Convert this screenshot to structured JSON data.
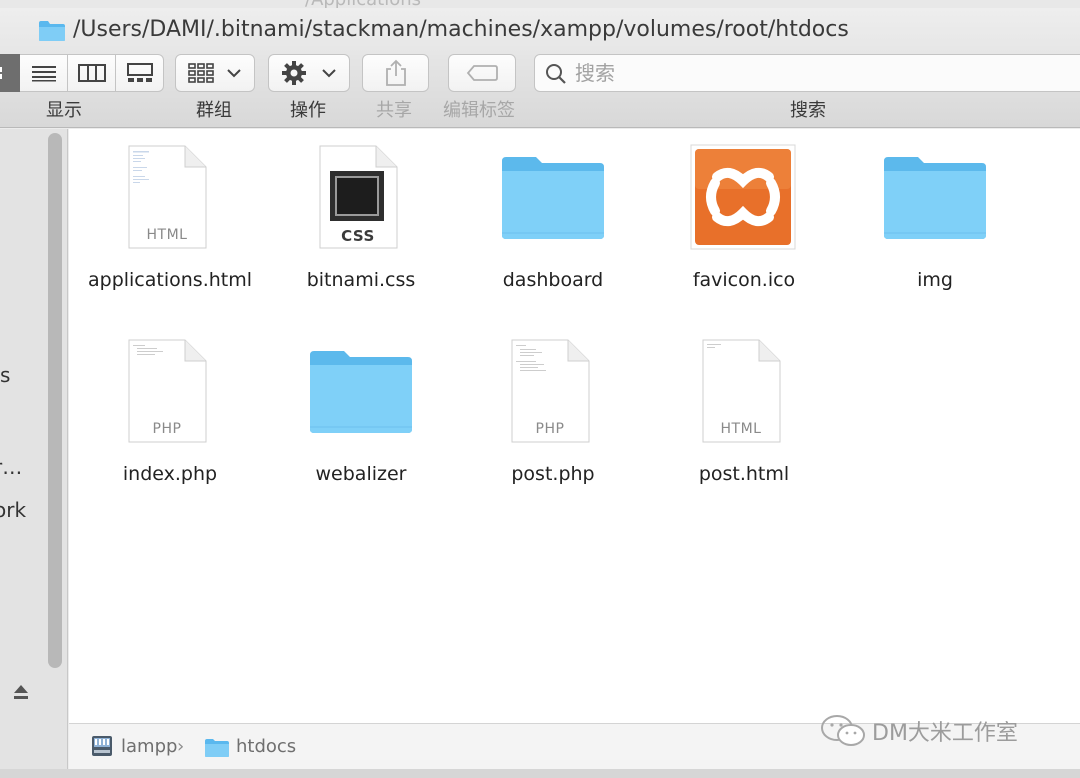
{
  "window": {
    "previous_path_fragment": "/Applications",
    "title_path": "/Users/DAMI/.bitnami/stackman/machines/xampp/volumes/root/htdocs"
  },
  "toolbar": {
    "view_label": "显示",
    "group_label": "群组",
    "action_label": "操作",
    "share_label": "共享",
    "tags_label": "编辑标签",
    "search_label": "搜索",
    "search_placeholder": "搜索"
  },
  "sidebar": {
    "fragments": [
      "s",
      "r…",
      "ork"
    ]
  },
  "files": [
    {
      "name": "applications.html",
      "kind": "html-doc",
      "ext": "HTML"
    },
    {
      "name": "bitnami.css",
      "kind": "css-doc",
      "ext": "CSS"
    },
    {
      "name": "dashboard",
      "kind": "folder"
    },
    {
      "name": "favicon.ico",
      "kind": "xampp-ico"
    },
    {
      "name": "img",
      "kind": "folder"
    },
    {
      "name": "index.php",
      "kind": "php-doc",
      "ext": "PHP"
    },
    {
      "name": "webalizer",
      "kind": "folder"
    },
    {
      "name": "post.php",
      "kind": "php-doc",
      "ext": "PHP"
    },
    {
      "name": "post.html",
      "kind": "html-doc",
      "ext": "HTML"
    }
  ],
  "pathbar": {
    "items": [
      "lampp",
      "htdocs"
    ],
    "separator": "›"
  },
  "watermark": {
    "text": "DM大米工作室"
  },
  "colors": {
    "folder_blue": "#6cc6f5",
    "xampp_orange": "#e8702a",
    "selected_view": "#6e6e6e"
  }
}
